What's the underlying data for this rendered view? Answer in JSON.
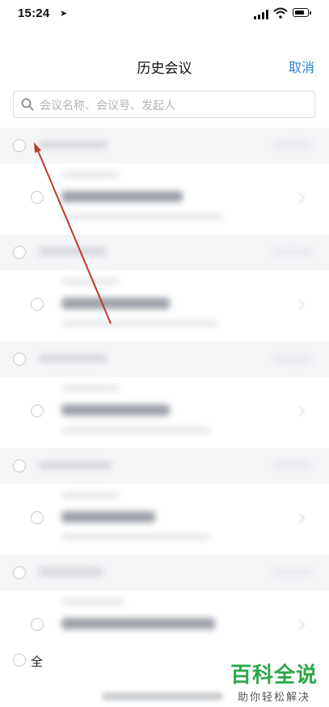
{
  "status_bar": {
    "time": "15:24"
  },
  "nav": {
    "title": "历史会议",
    "cancel_label": "取消"
  },
  "search": {
    "placeholder": "会议名称、会议号、发起人"
  },
  "groups": [
    {
      "header": "",
      "items": [
        {
          "title": ""
        }
      ]
    },
    {
      "header": "",
      "items": [
        {
          "title": ""
        }
      ]
    },
    {
      "header": "",
      "items": [
        {
          "title": ""
        }
      ]
    },
    {
      "header": "",
      "items": [
        {
          "title": ""
        }
      ]
    },
    {
      "header": "",
      "items": [
        {
          "title": ""
        }
      ]
    }
  ],
  "bottom": {
    "select_all_label": "全"
  },
  "watermark": {
    "main": "百科全说",
    "sub": "助你轻松解决"
  },
  "colors": {
    "accent": "#2f7fd4",
    "annotation_arrow": "#c0392b",
    "watermark_green": "#2ba84a"
  }
}
